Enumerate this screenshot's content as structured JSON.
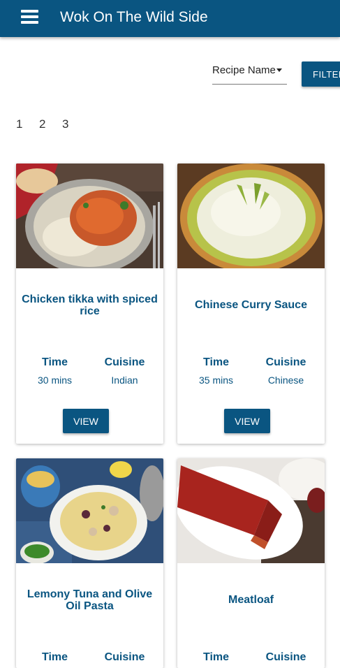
{
  "app": {
    "title": "Wok On The Wild Side"
  },
  "toolbar": {
    "sort_value": "Recipe Name",
    "filter_label": "FILTER"
  },
  "pagination": {
    "pages": [
      "1",
      "2",
      "3"
    ]
  },
  "card_labels": {
    "time": "Time",
    "cuisine": "Cuisine",
    "view": "VIEW"
  },
  "recipes": [
    {
      "name": "Chicken tikka with spiced rice",
      "time": "30 mins",
      "cuisine": "Indian"
    },
    {
      "name": "Chinese Curry Sauce",
      "time": "35 mins",
      "cuisine": "Chinese"
    },
    {
      "name": "Lemony Tuna and Olive Oil Pasta",
      "time": "",
      "cuisine": ""
    },
    {
      "name": "Meatloaf",
      "time": "",
      "cuisine": ""
    }
  ],
  "colors": {
    "primary": "#0a5581",
    "text": "#222222"
  }
}
